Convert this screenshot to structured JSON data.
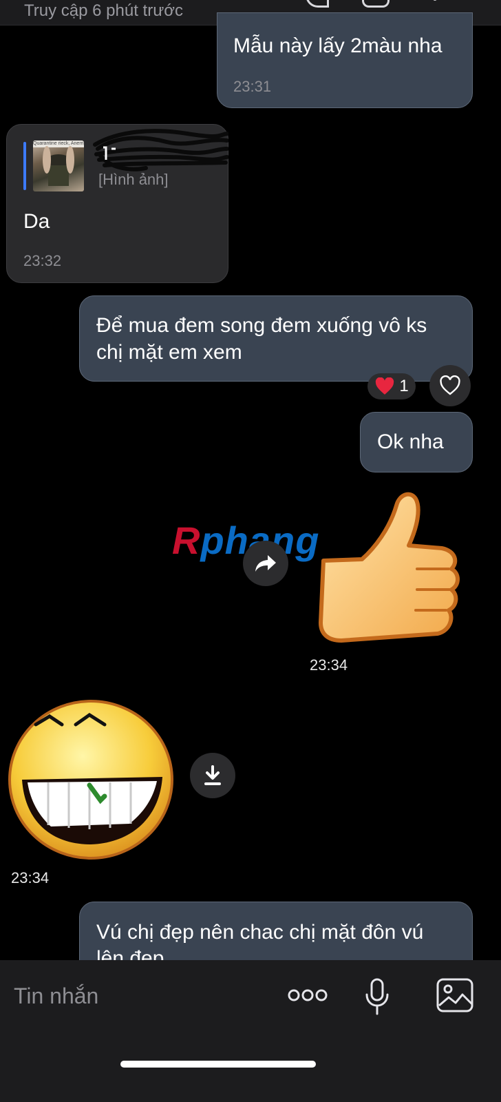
{
  "header": {
    "status": "Truy cập 6 phút trước"
  },
  "messages": {
    "m1": {
      "text": "Mẫu này lấy 2màu nha",
      "time": "23:31"
    },
    "m2": {
      "reply_caption": "Quarantine rieck, Anerrissan",
      "reply_type": "[Hình ảnh]",
      "text": "Da",
      "time": "23:32"
    },
    "m3": {
      "text_line1": "Để mua đem song đem xuống vô ks",
      "text_line2": "chị mặt em xem",
      "reaction_count": "1"
    },
    "m4": {
      "text": "Ok nha"
    },
    "m5": {
      "time": "23:34"
    },
    "m6": {
      "time": "23:34"
    },
    "m7": {
      "text_line1": "Vú chị đẹp nên chac chị mặt đôn vú",
      "text_line2": "lên đẹp"
    }
  },
  "watermark": {
    "first": "R",
    "rest": "phang"
  },
  "composer": {
    "placeholder": "Tin nhắn"
  },
  "colors": {
    "outgoing_bubble": "#3a4452",
    "incoming_bubble": "#2a2a2c",
    "reply_accent": "#3d7bff",
    "heart": "#e8263f"
  },
  "icons": [
    "phone-icon",
    "video-icon",
    "menu-icon",
    "heart-icon",
    "share-icon",
    "download-icon",
    "more-icon",
    "microphone-icon",
    "image-icon",
    "thumbs-up-sticker",
    "grin-sticker"
  ]
}
